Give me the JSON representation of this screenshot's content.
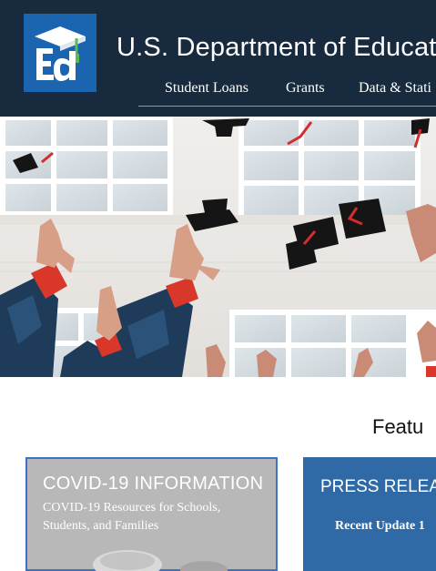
{
  "header": {
    "logo_text": "Ed",
    "site_title": "U.S. Department of Educat",
    "nav": [
      {
        "label": "Student Loans"
      },
      {
        "label": "Grants"
      },
      {
        "label": "Data & Stati"
      }
    ]
  },
  "hero": {
    "image_subject": "graduation-caps-thrown"
  },
  "featured": {
    "heading": "Featu",
    "cards": [
      {
        "title": "COVID-19 INFORMATION",
        "subtitle": "COVID-19 Resources for Schools, Students, and Families"
      },
      {
        "title": "PRESS RELEA",
        "subtitle": "Recent Update 1"
      }
    ]
  },
  "colors": {
    "header_bg": "#172a3e",
    "logo_bg": "#1b64b0",
    "logo_accent": "#5cb85c",
    "card_press_bg": "#2f6aa6",
    "card_covid_bg": "#b8b8b8",
    "card_covid_border": "#3b74c7"
  }
}
